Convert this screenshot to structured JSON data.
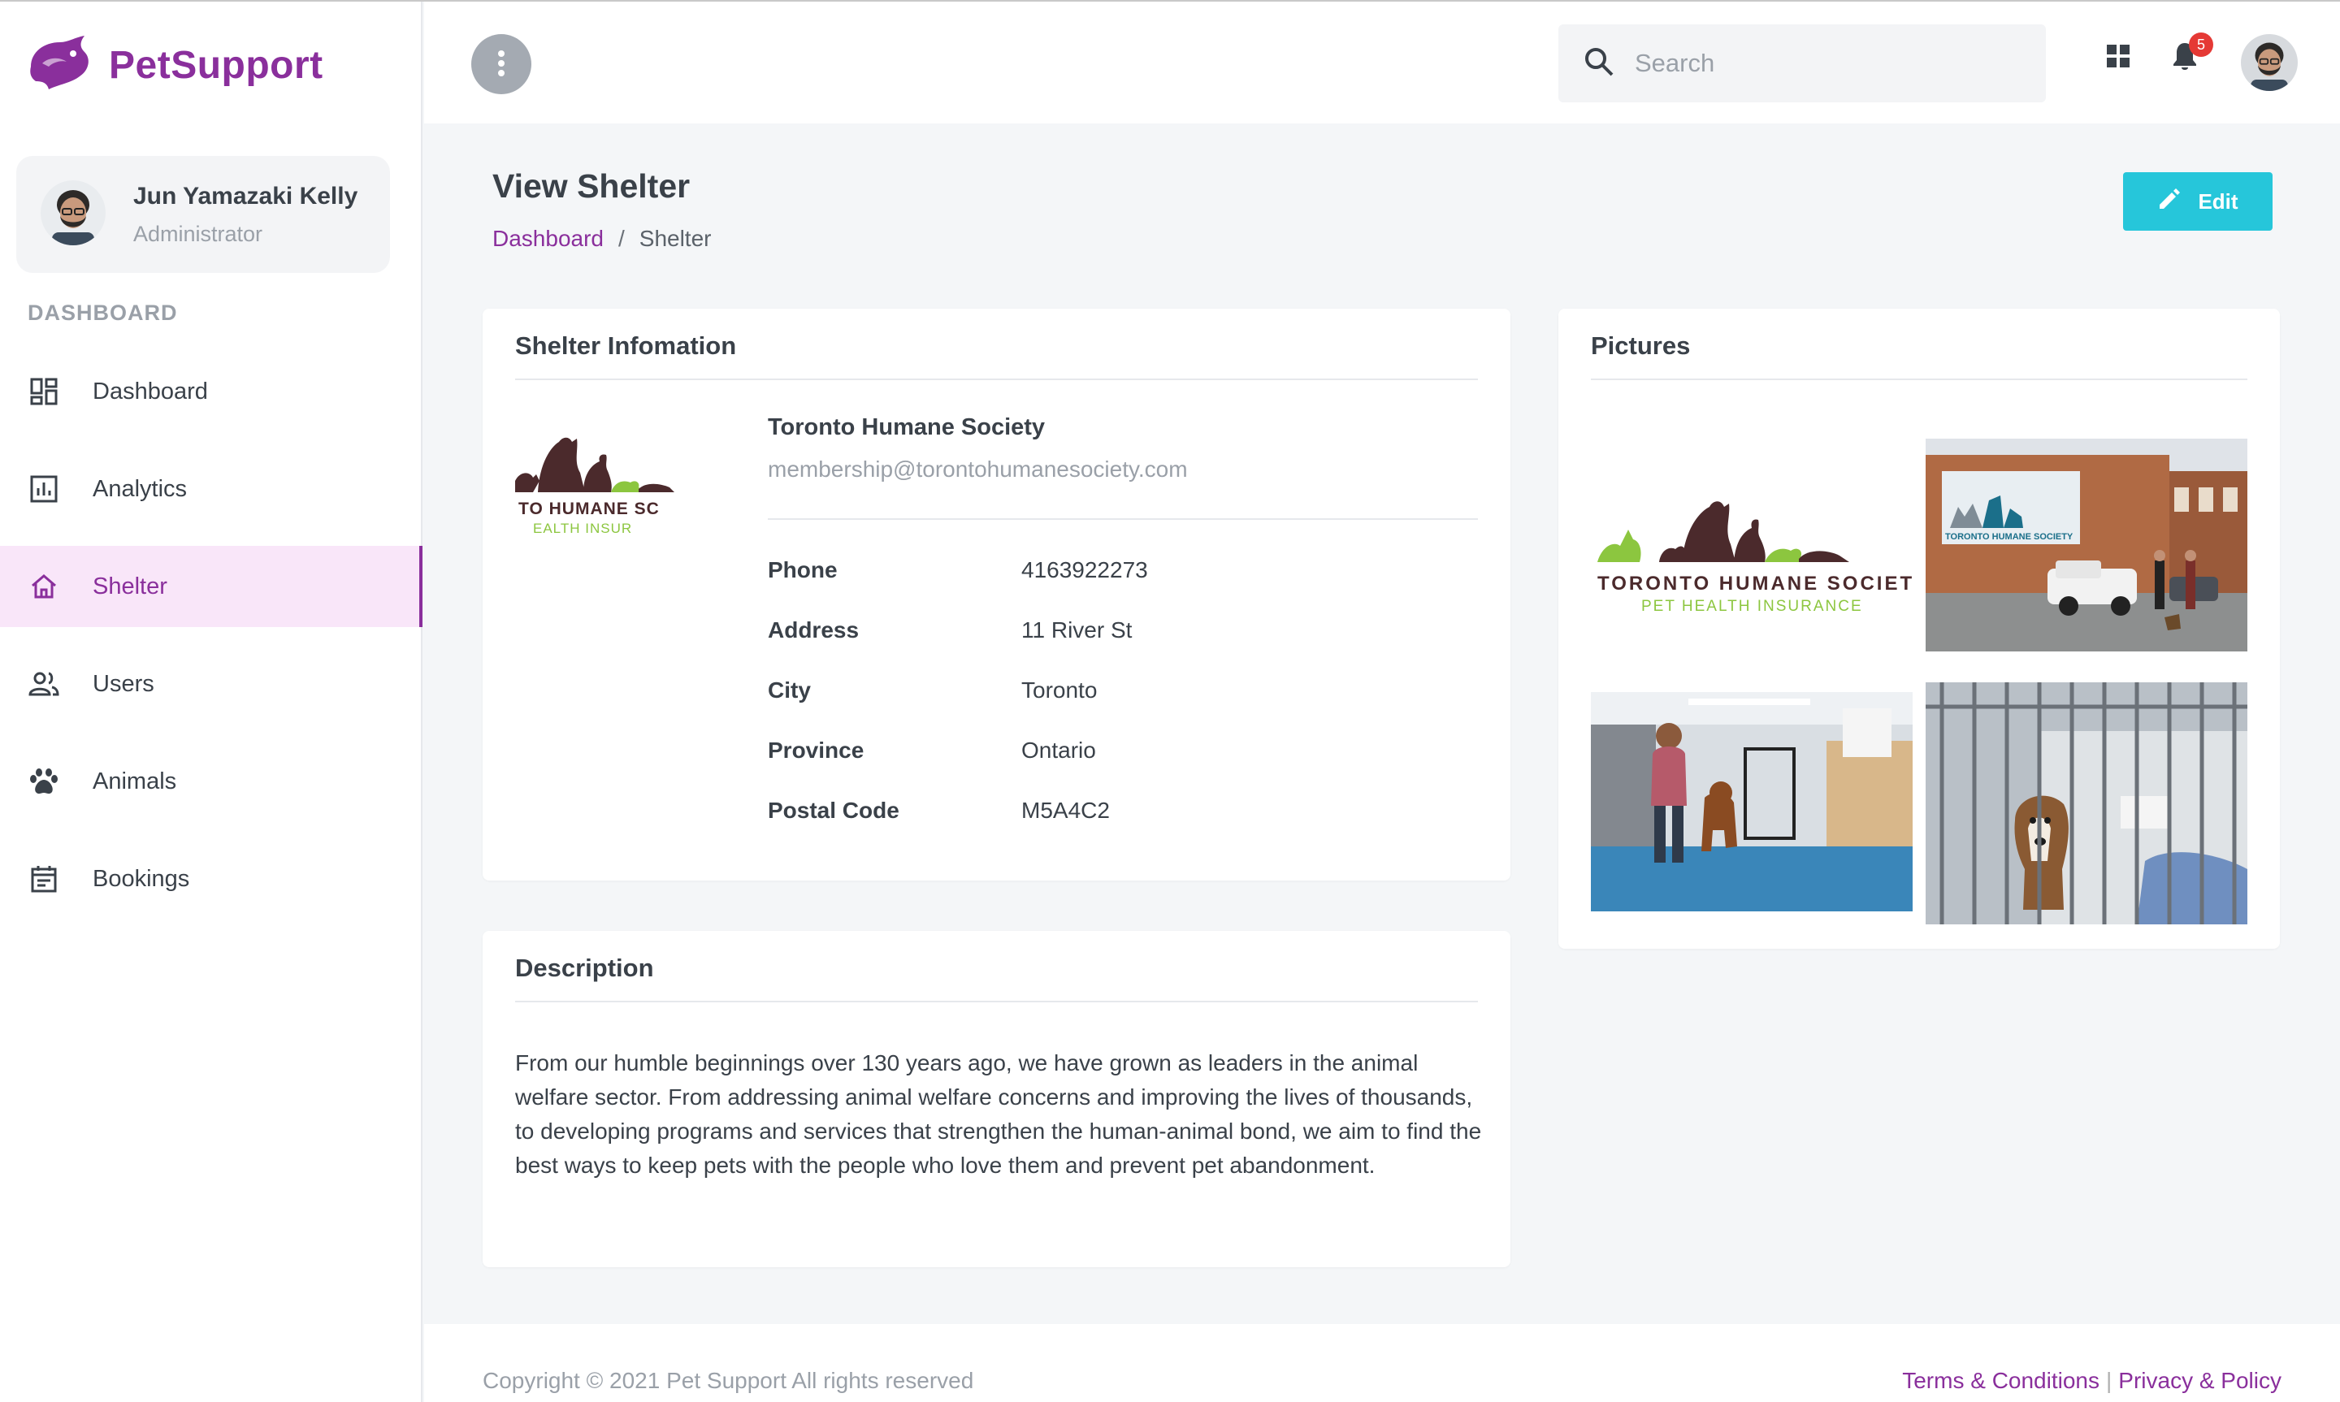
{
  "brand": {
    "name": "PetSupport",
    "color": "#8a2f9c"
  },
  "user": {
    "name": "Jun Yamazaki Kelly",
    "role": "Administrator"
  },
  "sidebar": {
    "section_title": "DASHBOARD",
    "items": [
      {
        "label": "Dashboard",
        "icon": "dashboard-icon"
      },
      {
        "label": "Analytics",
        "icon": "analytics-icon"
      },
      {
        "label": "Shelter",
        "icon": "home-icon",
        "active": true
      },
      {
        "label": "Users",
        "icon": "users-icon"
      },
      {
        "label": "Animals",
        "icon": "paw-icon"
      },
      {
        "label": "Bookings",
        "icon": "calendar-icon"
      }
    ]
  },
  "topbar": {
    "search_placeholder": "Search",
    "notification_count": "5"
  },
  "page": {
    "title": "View Shelter",
    "breadcrumb": {
      "link": "Dashboard",
      "separator": "/",
      "current": "Shelter"
    },
    "edit_label": "Edit"
  },
  "shelter_info": {
    "card_title": "Shelter Infomation",
    "name": "Toronto Humane Society",
    "email": "membership@torontohumanesociety.com",
    "logo_text_line1": "TORONTO HUMANE SOCIETY",
    "logo_text_line2": "PET HEALTH INSURANCE",
    "logo_crop_line1": "TO HUMANE SC",
    "logo_crop_line2": "EALTH INSUR",
    "fields": [
      {
        "label": "Phone",
        "value": "4163922273"
      },
      {
        "label": "Address",
        "value": "11 River St"
      },
      {
        "label": "City",
        "value": "Toronto"
      },
      {
        "label": "Province",
        "value": "Ontario"
      },
      {
        "label": "Postal Code",
        "value": "M5A4C2"
      }
    ]
  },
  "description": {
    "card_title": "Description",
    "text": "From our humble beginnings over 130 years ago, we have grown as leaders in the animal welfare sector. From addressing animal welfare concerns and improving the lives of thousands, to developing programs and services that strengthen the human-animal bond, we aim to find the best ways to keep pets with the people who love them and prevent pet abandonment."
  },
  "pictures": {
    "card_title": "Pictures",
    "building_sign": "TORONTO HUMANE SOCIETY"
  },
  "footer": {
    "copyright": "Copyright © 2021 Pet Support All rights reserved",
    "terms": "Terms & Conditions",
    "separator": "|",
    "privacy": "Privacy & Policy"
  },
  "colors": {
    "accent": "#8a2f9c",
    "edit_button": "#26c6da",
    "badge": "#e53935",
    "active_nav_bg": "#f9e6f9"
  }
}
